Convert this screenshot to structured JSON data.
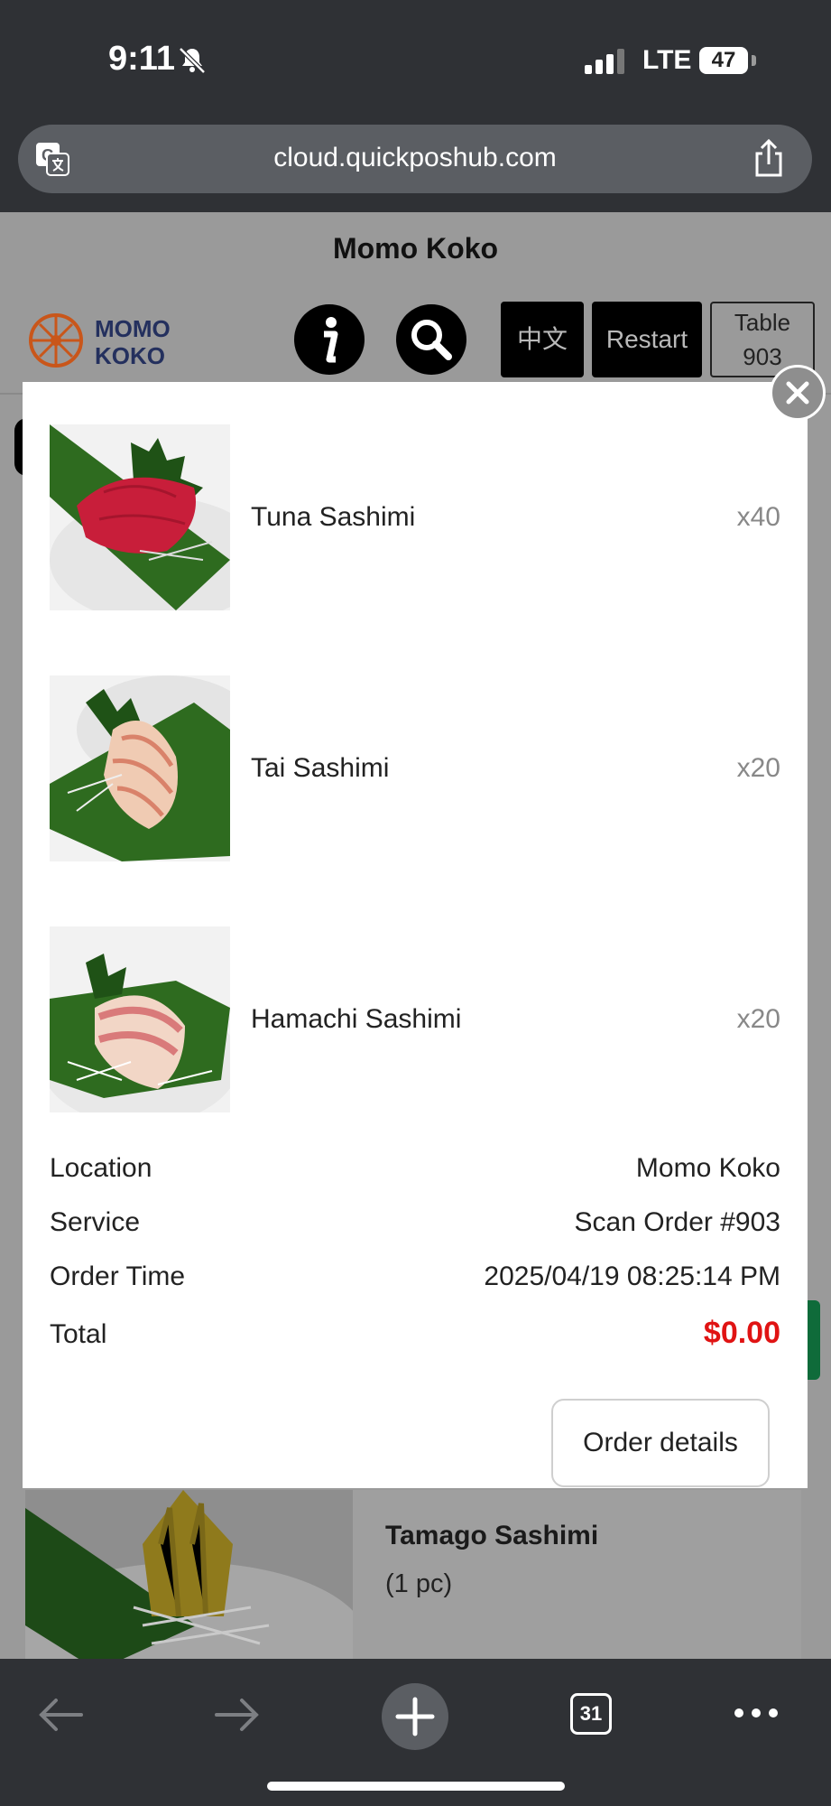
{
  "status_bar": {
    "time": "9:11",
    "network": "LTE",
    "battery": "47"
  },
  "browser": {
    "url": "cloud.quickposhub.com",
    "tab_count": "31"
  },
  "page": {
    "store_title": "Momo Koko",
    "language_button": "中文",
    "restart_button": "Restart",
    "table_label": "Table",
    "table_number": "903",
    "product": {
      "name": "Tamago Sashimi",
      "description": "(1 pc)"
    }
  },
  "modal": {
    "items": [
      {
        "name": "Tuna Sashimi",
        "qty": "x40"
      },
      {
        "name": "Tai Sashimi",
        "qty": "x20"
      },
      {
        "name": "Hamachi Sashimi",
        "qty": "x20"
      }
    ],
    "details": {
      "location_label": "Location",
      "location_value": "Momo Koko",
      "service_label": "Service",
      "service_value": "Scan Order #903",
      "order_time_label": "Order Time",
      "order_time_value": "2025/04/19 08:25:14 PM",
      "total_label": "Total",
      "total_value": "$0.00"
    },
    "order_details_button": "Order details"
  },
  "colors": {
    "total": "#e01313",
    "chrome": "#2f3135",
    "overlay": "#9a9a9a"
  }
}
